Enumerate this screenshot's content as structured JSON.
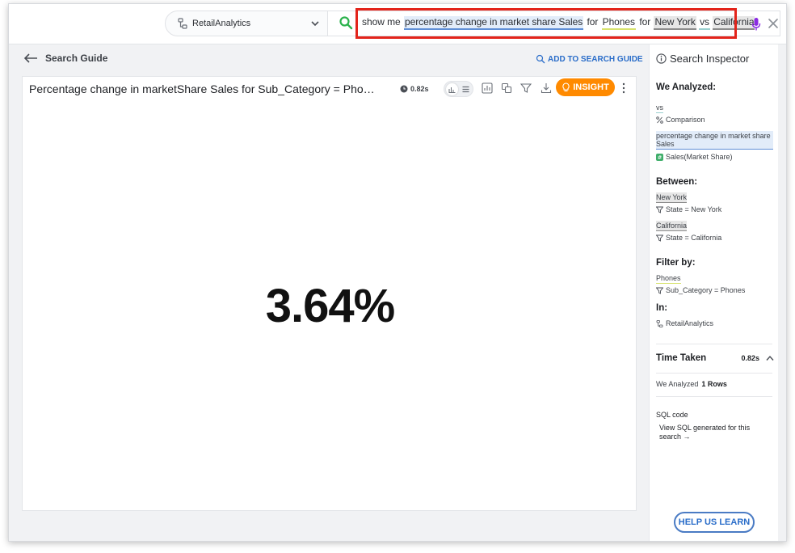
{
  "topbar": {
    "source": "RetailAnalytics",
    "query_tokens": [
      {
        "text": "show me",
        "kind": "plain"
      },
      {
        "text": "percentage change in market share Sales",
        "kind": "measure"
      },
      {
        "text": "for",
        "kind": "plain"
      },
      {
        "text": "Phones",
        "kind": "attr"
      },
      {
        "text": "for",
        "kind": "plain"
      },
      {
        "text": "New York",
        "kind": "value"
      },
      {
        "text": "vs",
        "kind": "kw"
      },
      {
        "text": "California",
        "kind": "value"
      }
    ]
  },
  "main": {
    "back_label": "Search Guide",
    "add_guide_label": "ADD TO SEARCH GUIDE",
    "card": {
      "title": "Percentage change in marketShare Sales for Sub_Category = Phones for New York vs California",
      "time": "0.82s",
      "insight_label": "INSIGHT",
      "kpi_value": "3.64%"
    }
  },
  "inspector": {
    "title": "Search Inspector",
    "analyzed_heading": "We Analyzed:",
    "vs_token": "vs",
    "vs_desc": "Comparison",
    "measure_token": "percentage change in market share Sales",
    "measure_desc": "Sales(Market Share)",
    "between_heading": "Between:",
    "ny_token": "New York",
    "ny_desc": "State = New York",
    "ca_token": "California",
    "ca_desc": "State = California",
    "filter_heading": "Filter by:",
    "phones_token": "Phones",
    "phones_desc": "Sub_Category = Phones",
    "in_heading": "In:",
    "in_desc": "RetailAnalytics",
    "time_heading": "Time Taken",
    "time_value": "0.82s",
    "rows_label": "We Analyzed",
    "rows_value": "1 Rows",
    "sql_label": "SQL code",
    "sql_link": "View SQL generated for this search",
    "help_label": "HELP US LEARN"
  },
  "colors": {
    "accent_orange": "#ff8a00",
    "link_blue": "#2a6dc9",
    "highlight_red": "#e3241b",
    "search_green": "#2bb24c"
  }
}
